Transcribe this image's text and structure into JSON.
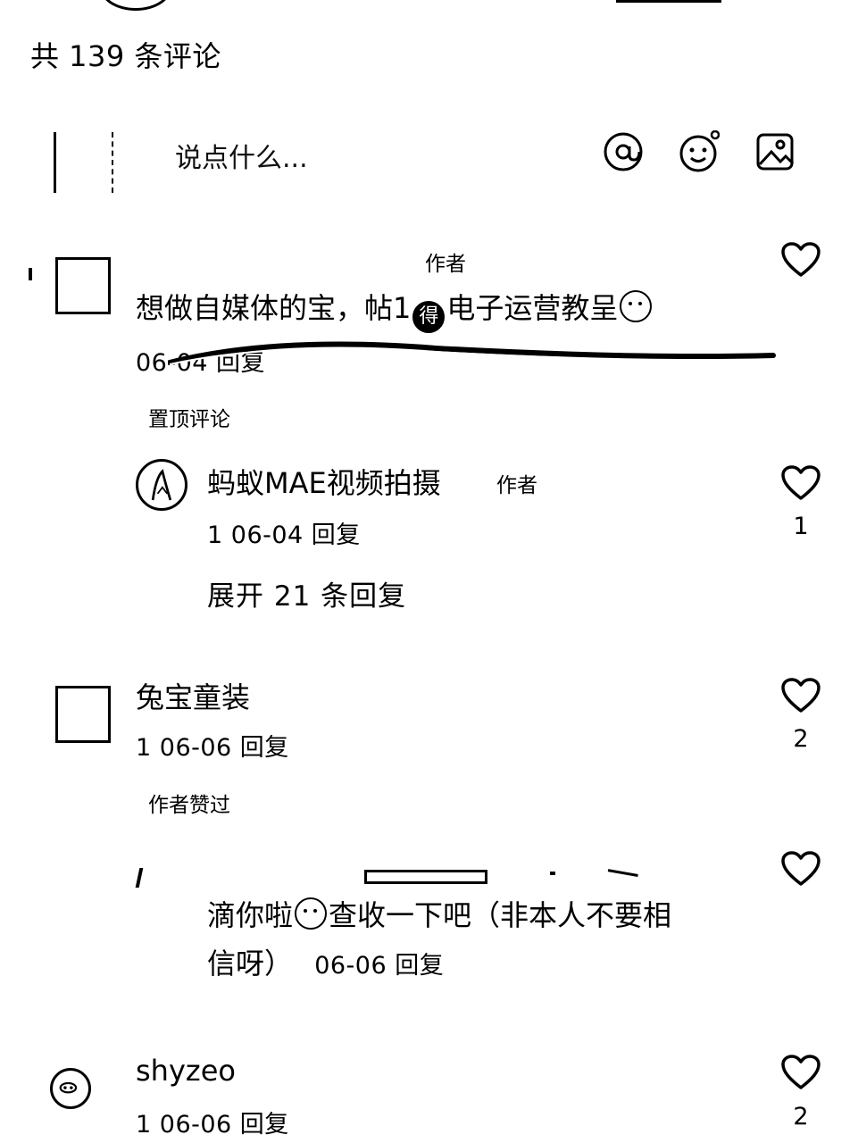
{
  "comments_header": {
    "count_text": "共 139 条评论"
  },
  "input": {
    "placeholder": "说点什么..."
  },
  "toolbar": {
    "at_icon": "at-icon",
    "emoji_icon": "smile-icon",
    "image_icon": "image-icon"
  },
  "comments": [
    {
      "author_tag": "作者",
      "text_part1": "想做自媒体的宝，帖1",
      "text_emoji": "得",
      "text_part2": "电子运营教呈",
      "meta": "06-04 回复",
      "pinned_label": "置顶评论",
      "likes": ""
    },
    {
      "name": "蚂蚁MAE视频拍摄",
      "author_tag": "作者",
      "meta": "1 06-04 回复",
      "likes": "1",
      "expand": "展开 21 条回复"
    },
    {
      "name": "兔宝童装",
      "meta": "1 06-06 回复",
      "likes": "2",
      "liked_label": "作者赞过"
    },
    {
      "text_part1": "滴你啦",
      "text_part2": "查收一下吧（非本人不要相",
      "text_line2": "信呀）",
      "meta": "06-06 回复",
      "likes": ""
    },
    {
      "name": "shyzeo",
      "meta": "1 06-06 回复",
      "likes": "2"
    }
  ]
}
